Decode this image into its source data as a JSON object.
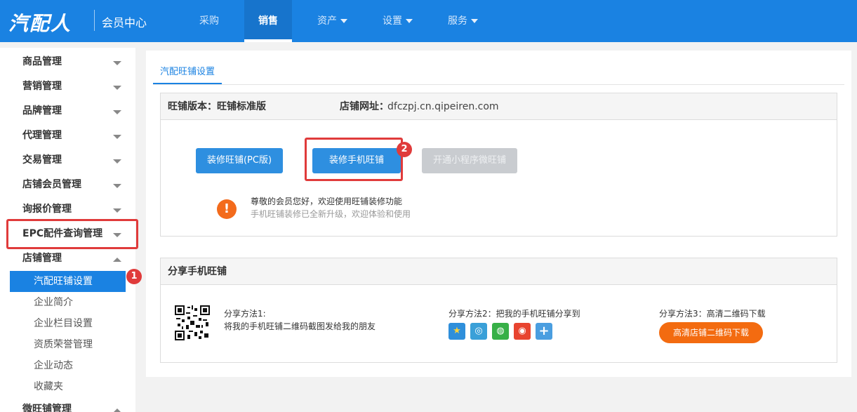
{
  "header": {
    "logo": "汽配人",
    "portal_title": "会员中心",
    "nav": [
      {
        "label": "采购",
        "caret": false,
        "active": false
      },
      {
        "label": "销售",
        "caret": false,
        "active": true
      },
      {
        "label": "资产",
        "caret": true,
        "active": false
      },
      {
        "label": "设置",
        "caret": true,
        "active": false
      },
      {
        "label": "服务",
        "caret": true,
        "active": false
      }
    ]
  },
  "sidebar": {
    "groups": [
      {
        "label": "商品管理",
        "expanded": false
      },
      {
        "label": "营销管理",
        "expanded": false
      },
      {
        "label": "品牌管理",
        "expanded": false
      },
      {
        "label": "代理管理",
        "expanded": false
      },
      {
        "label": "交易管理",
        "expanded": false
      },
      {
        "label": "店铺会员管理",
        "expanded": false
      },
      {
        "label": "询报价管理",
        "expanded": false
      },
      {
        "label": "EPC配件查询管理",
        "expanded": false
      },
      {
        "label": "店铺管理",
        "expanded": true
      }
    ],
    "sub_items": [
      {
        "label": "汽配旺铺设置",
        "active": true
      },
      {
        "label": "企业简介",
        "active": false
      },
      {
        "label": "企业栏目设置",
        "active": false
      },
      {
        "label": "资质荣誉管理",
        "active": false
      },
      {
        "label": "企业动态",
        "active": false
      },
      {
        "label": "收藏夹",
        "active": false
      }
    ],
    "last_group": "微旺铺管理",
    "badge1": "1"
  },
  "main": {
    "tab": "汽配旺铺设置",
    "shop": {
      "version_label": "旺铺版本：",
      "version_value": "旺铺标准版",
      "url_label": "店铺网址：",
      "url_value": "dfczpj.cn.qipeiren.com"
    },
    "buttons": {
      "pc": "装修旺铺(PC版)",
      "mobile": "装修手机旺铺",
      "mini": "开通小程序微旺铺"
    },
    "badge2": "2",
    "notice": {
      "icon": "!",
      "line1": "尊敬的会员您好，欢迎使用旺铺装修功能",
      "line2": "手机旺铺装修已全新升级，欢迎体验和使用"
    },
    "share": {
      "title": "分享手机旺铺",
      "method1_title": "分享方法1:",
      "method1_desc": "将我的手机旺铺二维码截图发给我的朋友",
      "method2_title": "分享方法2：把我的手机旺铺分享到",
      "method3_title": "分享方法3：高清二维码下载",
      "download_button": "高清店铺二维码下载",
      "icons": [
        {
          "name": "qzone-icon",
          "glyph": "★",
          "color": "#2f8fdb"
        },
        {
          "name": "tencent-weibo-icon",
          "glyph": "◎",
          "color": "#3aa0d8"
        },
        {
          "name": "wechat-icon",
          "glyph": "◍",
          "color": "#37b047"
        },
        {
          "name": "sina-weibo-icon",
          "glyph": "◉",
          "color": "#e8442f"
        },
        {
          "name": "more-share-icon",
          "glyph": "+",
          "color": "#4a9ee0"
        }
      ]
    }
  }
}
